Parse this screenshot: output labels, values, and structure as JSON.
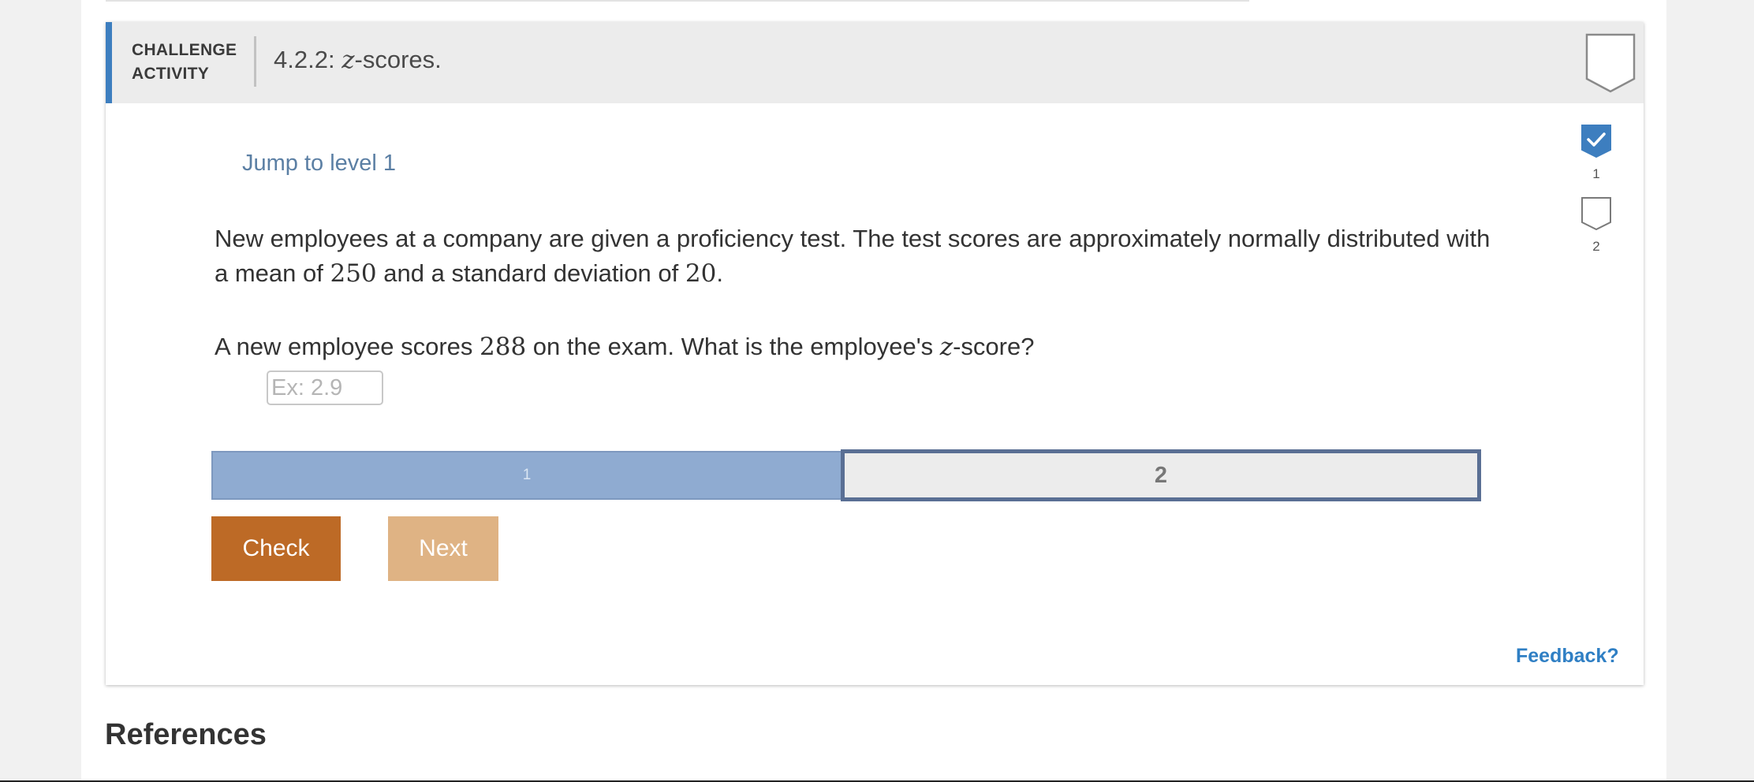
{
  "activity": {
    "label_line1": "CHALLENGE",
    "label_line2": "ACTIVITY",
    "title_prefix": "4.2.2: ",
    "title_var": "z",
    "title_suffix": "-scores."
  },
  "jump_link": "Jump to level 1",
  "problem": {
    "part1": "New employees at a company are given a proficiency test. The test scores are approximately normally distributed with a mean of ",
    "mean": "250",
    "part2": " and a standard deviation of ",
    "sd": "20",
    "part3": "."
  },
  "question": {
    "part1": "A new employee scores ",
    "score": "288",
    "part2": " on the exam. What is the employee's ",
    "var": "z",
    "part3": "-score?"
  },
  "answer": {
    "placeholder": "Ex: 2.9",
    "value": ""
  },
  "levels": [
    {
      "number": "1",
      "completed": true
    },
    {
      "number": "2",
      "completed": false
    }
  ],
  "progress_segments": [
    {
      "label": "1",
      "state": "completed"
    },
    {
      "label": "2",
      "state": "current"
    }
  ],
  "buttons": {
    "check": "Check",
    "next": "Next"
  },
  "feedback": "Feedback?",
  "references_heading": "References",
  "colors": {
    "accent_blue": "#3d7ebf",
    "check_button": "#bd6a26",
    "next_button": "#dfb384",
    "progress_completed": "#8fabd1",
    "progress_current_border": "#5a6f94",
    "feedback_link": "#2f7fc4"
  }
}
